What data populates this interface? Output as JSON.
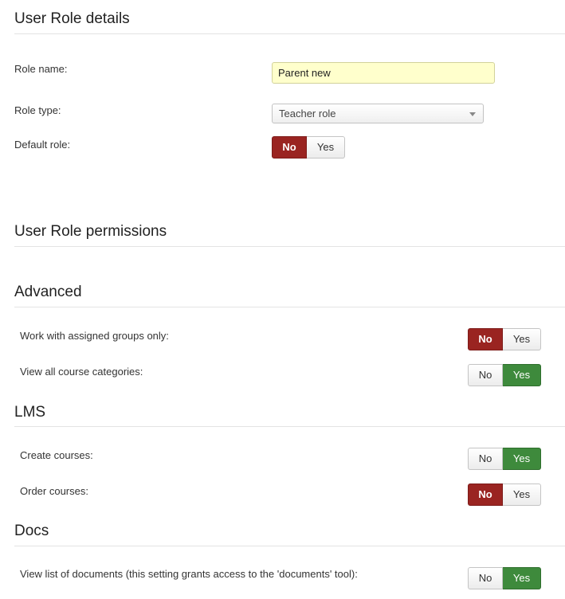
{
  "details": {
    "heading": "User Role details",
    "role_name_label": "Role name:",
    "role_name_value": "Parent new",
    "role_type_label": "Role type:",
    "role_type_value": "Teacher role",
    "default_role_label": "Default role:",
    "default_role": "No"
  },
  "permissions": {
    "heading": "User Role permissions"
  },
  "toggle_labels": {
    "no": "No",
    "yes": "Yes"
  },
  "colors": {
    "no_active": "#9a2421",
    "yes_active": "#3e8a3c",
    "name_field_bg": "#ffffcc"
  },
  "advanced": {
    "heading": "Advanced",
    "items": [
      {
        "label": "Work with assigned groups only:",
        "value": "No"
      },
      {
        "label": "View all course categories:",
        "value": "Yes"
      }
    ]
  },
  "lms": {
    "heading": "LMS",
    "items": [
      {
        "label": "Create courses:",
        "value": "Yes"
      },
      {
        "label": "Order courses:",
        "value": "No"
      }
    ]
  },
  "docs": {
    "heading": "Docs",
    "items": [
      {
        "label": "View list of documents (this setting grants access to the 'documents' tool):",
        "value": "Yes"
      }
    ]
  }
}
